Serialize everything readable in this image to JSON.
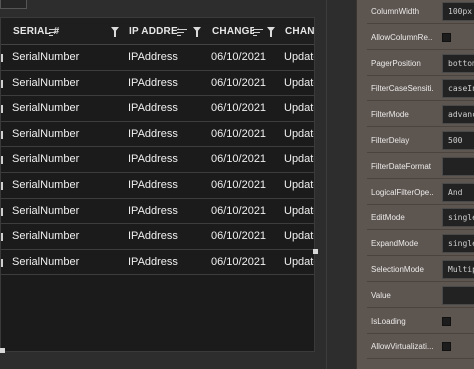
{
  "grid": {
    "columns": [
      {
        "label": "SERIAL #",
        "sortable": true,
        "filterable": true
      },
      {
        "label": "IP ADDRESS",
        "sortable": true,
        "filterable": true
      },
      {
        "label": "CHANGED",
        "sortable": true,
        "filterable": true
      },
      {
        "label": "CHANGE"
      }
    ],
    "rows": [
      [
        "SerialNumber",
        "IPAddress",
        "06/10/2021",
        "Updatec"
      ],
      [
        "SerialNumber",
        "IPAddress",
        "06/10/2021",
        "Updatec"
      ],
      [
        "SerialNumber",
        "IPAddress",
        "06/10/2021",
        "Updatec"
      ],
      [
        "SerialNumber",
        "IPAddress",
        "06/10/2021",
        "Updatec"
      ],
      [
        "SerialNumber",
        "IPAddress",
        "06/10/2021",
        "Updatec"
      ],
      [
        "SerialNumber",
        "IPAddress",
        "06/10/2021",
        "Updatec"
      ],
      [
        "SerialNumber",
        "IPAddress",
        "06/10/2021",
        "Updatec"
      ],
      [
        "SerialNumber",
        "IPAddress",
        "06/10/2021",
        "Updatec"
      ],
      [
        "SerialNumber",
        "IPAddress",
        "06/10/2021",
        "Updatec"
      ]
    ]
  },
  "properties": [
    {
      "label": "ColumnWidth",
      "type": "text",
      "value": "100px"
    },
    {
      "label": "AllowColumnRe...",
      "type": "checkbox",
      "checked": false
    },
    {
      "label": "PagerPosition",
      "type": "text",
      "value": "bottom"
    },
    {
      "label": "FilterCaseSensiti...",
      "type": "text",
      "value": "caseInse"
    },
    {
      "label": "FilterMode",
      "type": "text",
      "value": "advanced"
    },
    {
      "label": "FilterDelay",
      "type": "text",
      "value": "500"
    },
    {
      "label": "FilterDateFormat",
      "type": "text",
      "value": ""
    },
    {
      "label": "LogicalFilterOpe...",
      "type": "text",
      "value": "And"
    },
    {
      "label": "EditMode",
      "type": "text",
      "value": "single"
    },
    {
      "label": "ExpandMode",
      "type": "text",
      "value": "single"
    },
    {
      "label": "SelectionMode",
      "type": "text",
      "value": "Multiple"
    },
    {
      "label": "Value",
      "type": "text",
      "value": ""
    },
    {
      "label": "IsLoading",
      "type": "checkbox",
      "checked": false
    },
    {
      "label": "AllowVirtualizati...",
      "type": "checkbox",
      "checked": false
    }
  ]
}
